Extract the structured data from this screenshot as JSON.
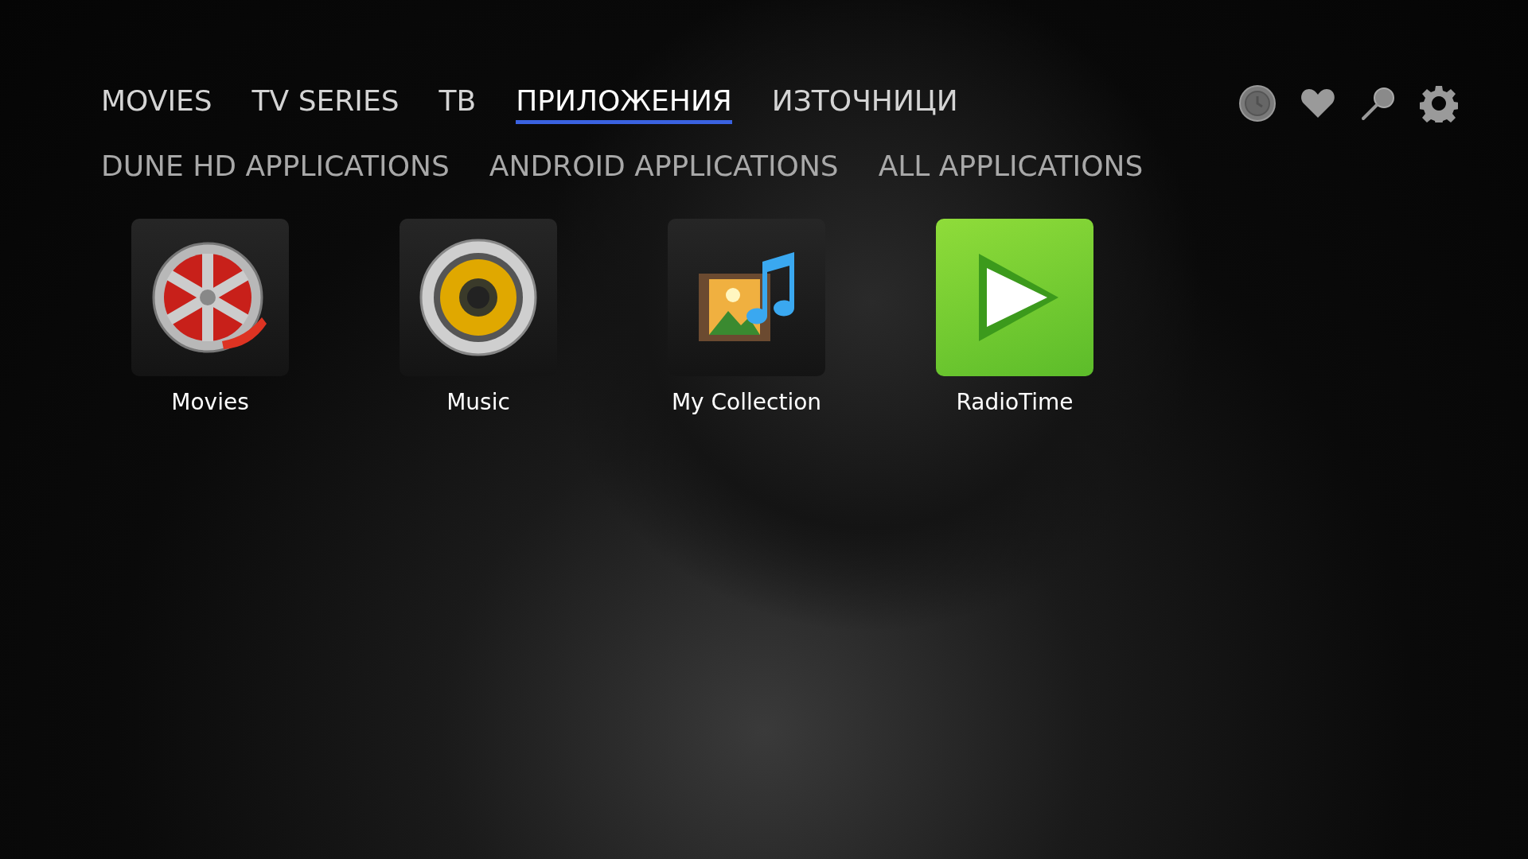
{
  "main_tabs": [
    {
      "label": "MOVIES",
      "selected": false
    },
    {
      "label": "TV SERIES",
      "selected": false
    },
    {
      "label": "ТВ",
      "selected": false
    },
    {
      "label": "ПРИЛОЖЕНИЯ",
      "selected": true
    },
    {
      "label": "ИЗТОЧНИЦИ",
      "selected": false
    }
  ],
  "toolbar": [
    {
      "kind": "history"
    },
    {
      "kind": "favorites"
    },
    {
      "kind": "search"
    },
    {
      "kind": "settings"
    }
  ],
  "sub_tabs": [
    "DUNE HD APPLICATIONS",
    "ANDROID APPLICATIONS",
    "ALL APPLICATIONS"
  ],
  "apps": [
    {
      "kind": "reel",
      "label": "Movies"
    },
    {
      "kind": "speaker",
      "label": "Music"
    },
    {
      "kind": "media",
      "label": "My Collection"
    },
    {
      "kind": "play",
      "label": "RadioTime"
    }
  ]
}
